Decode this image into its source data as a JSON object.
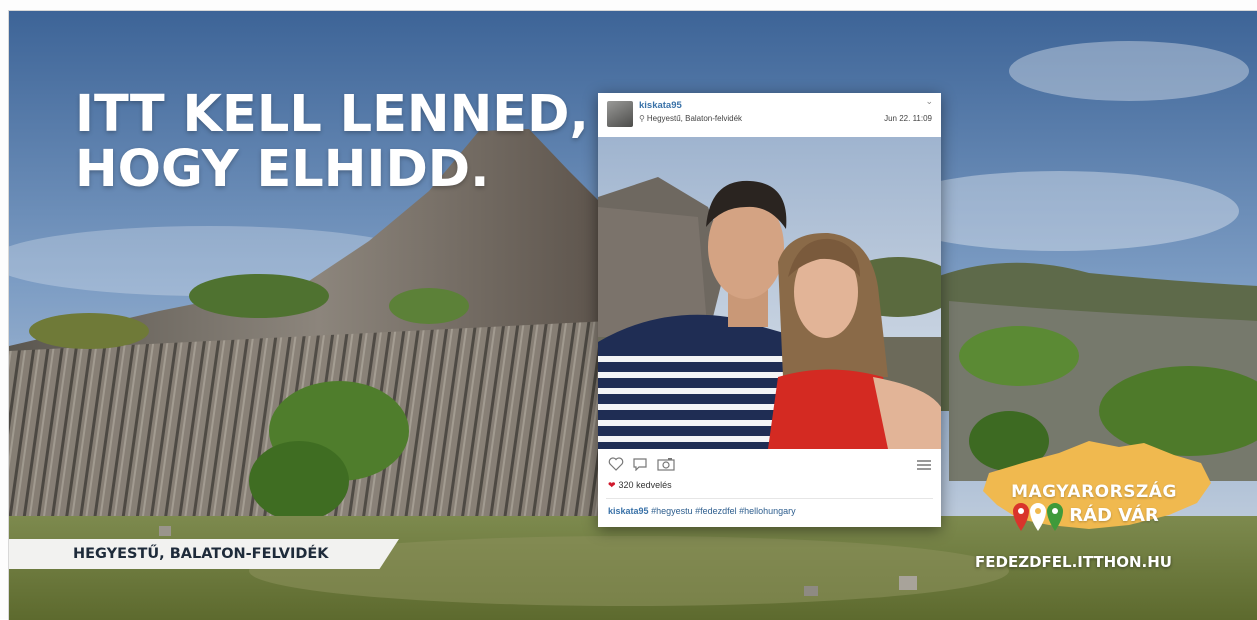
{
  "headline": {
    "line1": "ITT KELL LENNED,",
    "line2": "HOGY ELHIDD."
  },
  "location_label": "HEGYESTŰ, BALATON-FELVIDÉK",
  "post": {
    "username": "kiskata95",
    "location": "Hegyestű, Balaton-felvidék",
    "timestamp": "Jun 22. 11:09",
    "likes": "320 kedvelés",
    "caption_user": "kiskata95",
    "caption_tags": "#hegyestu #fedezdfel #hellohungary",
    "icons": [
      "heart-outline-icon",
      "comment-icon",
      "camera-icon",
      "more-icon",
      "location-pin-icon",
      "chevron-down-icon"
    ]
  },
  "brand": {
    "line1": "MAGYARORSZÁG",
    "line2": "RÁD VÁR",
    "url": "FEDEZDFEL.ITTHON.HU",
    "colors": {
      "map_fill": "#f0b94f",
      "pin_red": "#d9342b",
      "pin_white": "#ffffff",
      "pin_green": "#3f9a3a"
    }
  },
  "colors": {
    "headline": "#ffffff",
    "ribbon_bg": "#f2f2f0",
    "ribbon_text": "#1e2b3a",
    "username": "#3a72a8",
    "heart": "#d0182c"
  }
}
